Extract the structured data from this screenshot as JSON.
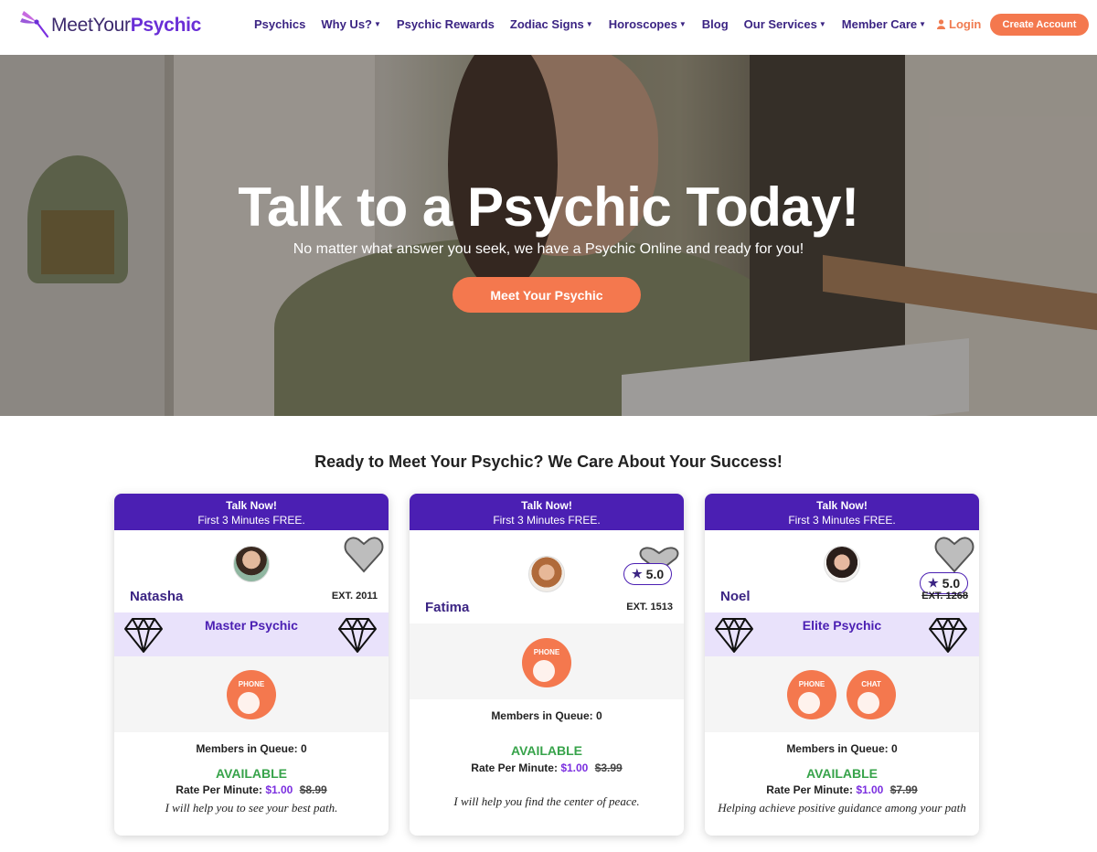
{
  "header": {
    "logo": {
      "prefix": "MeetYour",
      "brand": "Psychic"
    },
    "nav": [
      {
        "label": "Psychics",
        "dropdown": false
      },
      {
        "label": "Why Us?",
        "dropdown": true
      },
      {
        "label": "Psychic Rewards",
        "dropdown": false
      },
      {
        "label": "Zodiac Signs",
        "dropdown": true
      },
      {
        "label": "Horoscopes",
        "dropdown": true
      },
      {
        "label": "Blog",
        "dropdown": false
      },
      {
        "label": "Our Services",
        "dropdown": true
      },
      {
        "label": "Member Care",
        "dropdown": true
      }
    ],
    "login_label": "Login",
    "create_label": "Create Account"
  },
  "hero": {
    "title": "Talk to a Psychic Today!",
    "subtitle": "No matter what answer you seek, we have a Psychic Online and ready for you!",
    "cta": "Meet Your Psychic"
  },
  "section": {
    "title": "Ready to Meet Your Psychic? We Care About Your Success!"
  },
  "cards": [
    {
      "head_title": "Talk Now!",
      "head_sub": "First 3 Minutes FREE.",
      "name": "Natasha",
      "ext": "EXT. 2011",
      "rating": "",
      "tier": "Master Psychic",
      "buttons": [
        "PHONE"
      ],
      "queue": "Members in Queue: 0",
      "status": "AVAILABLE",
      "rate_label": "Rate Per Minute:",
      "price": "$1.00",
      "old_price": "$8.99",
      "tagline": "I will help you to see your best path."
    },
    {
      "head_title": "Talk Now!",
      "head_sub": "First 3 Minutes FREE.",
      "name": "Fatima",
      "ext": "EXT. 1513",
      "rating": "5.0",
      "tier": "",
      "buttons": [
        "PHONE"
      ],
      "queue": "Members in Queue: 0",
      "status": "AVAILABLE",
      "rate_label": "Rate Per Minute:",
      "price": "$1.00",
      "old_price": "$3.99",
      "tagline": "I will help you find the center of peace."
    },
    {
      "head_title": "Talk Now!",
      "head_sub": "First 3 Minutes FREE.",
      "name": "Noel",
      "ext": "EXT. 1268",
      "rating": "5.0",
      "tier": "Elite Psychic",
      "buttons": [
        "PHONE",
        "CHAT"
      ],
      "queue": "Members in Queue: 0",
      "status": "AVAILABLE",
      "rate_label": "Rate Per Minute:",
      "price": "$1.00",
      "old_price": "$7.99",
      "tagline": "Helping achieve positive guidance among your path"
    }
  ],
  "colors": {
    "accent": "#f4784e",
    "brand_purple": "#4b1fb3",
    "nav_text": "#3b2483",
    "available": "#37a34a"
  }
}
